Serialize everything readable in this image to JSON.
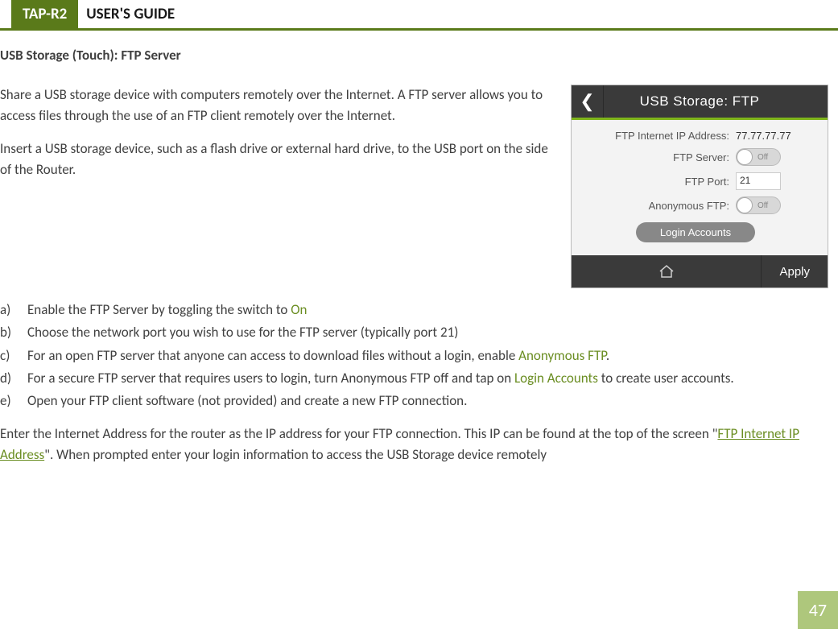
{
  "header": {
    "badge": "TAP-R2",
    "title": "USER'S GUIDE"
  },
  "section_title": "USB Storage (Touch): FTP Server",
  "para1": "Share a USB storage device with computers remotely over the Internet. A FTP server allows you to access files through the use of an FTP client remotely over the Internet.",
  "para2": "Insert a USB storage device, such as a flash drive or external hard drive, to the USB port on the side of the Router.",
  "list": {
    "a": {
      "lbl": "a)",
      "pre": "Enable the FTP Server by toggling the switch to ",
      "hi": "On"
    },
    "b": {
      "lbl": "b)",
      "txt": "Choose the network port you wish to use for the FTP server (typically port 21)"
    },
    "c": {
      "lbl": "c)",
      "pre": "For an open FTP server that anyone can access to download files without a login, enable ",
      "hi": "Anonymous FTP",
      "post": "."
    },
    "d": {
      "lbl": "d)",
      "pre": "For a secure FTP server that requires users to login, turn Anonymous FTP off and tap on ",
      "hi": "Login Accounts",
      "post": " to create user accounts."
    },
    "e": {
      "lbl": "e)",
      "txt": "Open your FTP client software (not provided) and create a new FTP connection."
    }
  },
  "para3": {
    "pre": "Enter the Internet Address for the router as the IP address for your FTP connection.  This IP can be found at the top of the screen \"",
    "hi": "FTP Internet IP Address",
    "post": "\".  When prompted enter your login information to access the USB Storage device remotely"
  },
  "phone": {
    "title": "USB Storage: FTP",
    "rows": {
      "ip_label": "FTP Internet IP Address:",
      "ip_value": "77.77.77.77",
      "server_label": "FTP Server:",
      "server_off": "Off",
      "port_label": "FTP Port:",
      "port_value": "21",
      "anon_label": "Anonymous FTP:",
      "anon_off": "Off"
    },
    "login_btn": "Login Accounts",
    "apply": "Apply"
  },
  "page_number": "47"
}
